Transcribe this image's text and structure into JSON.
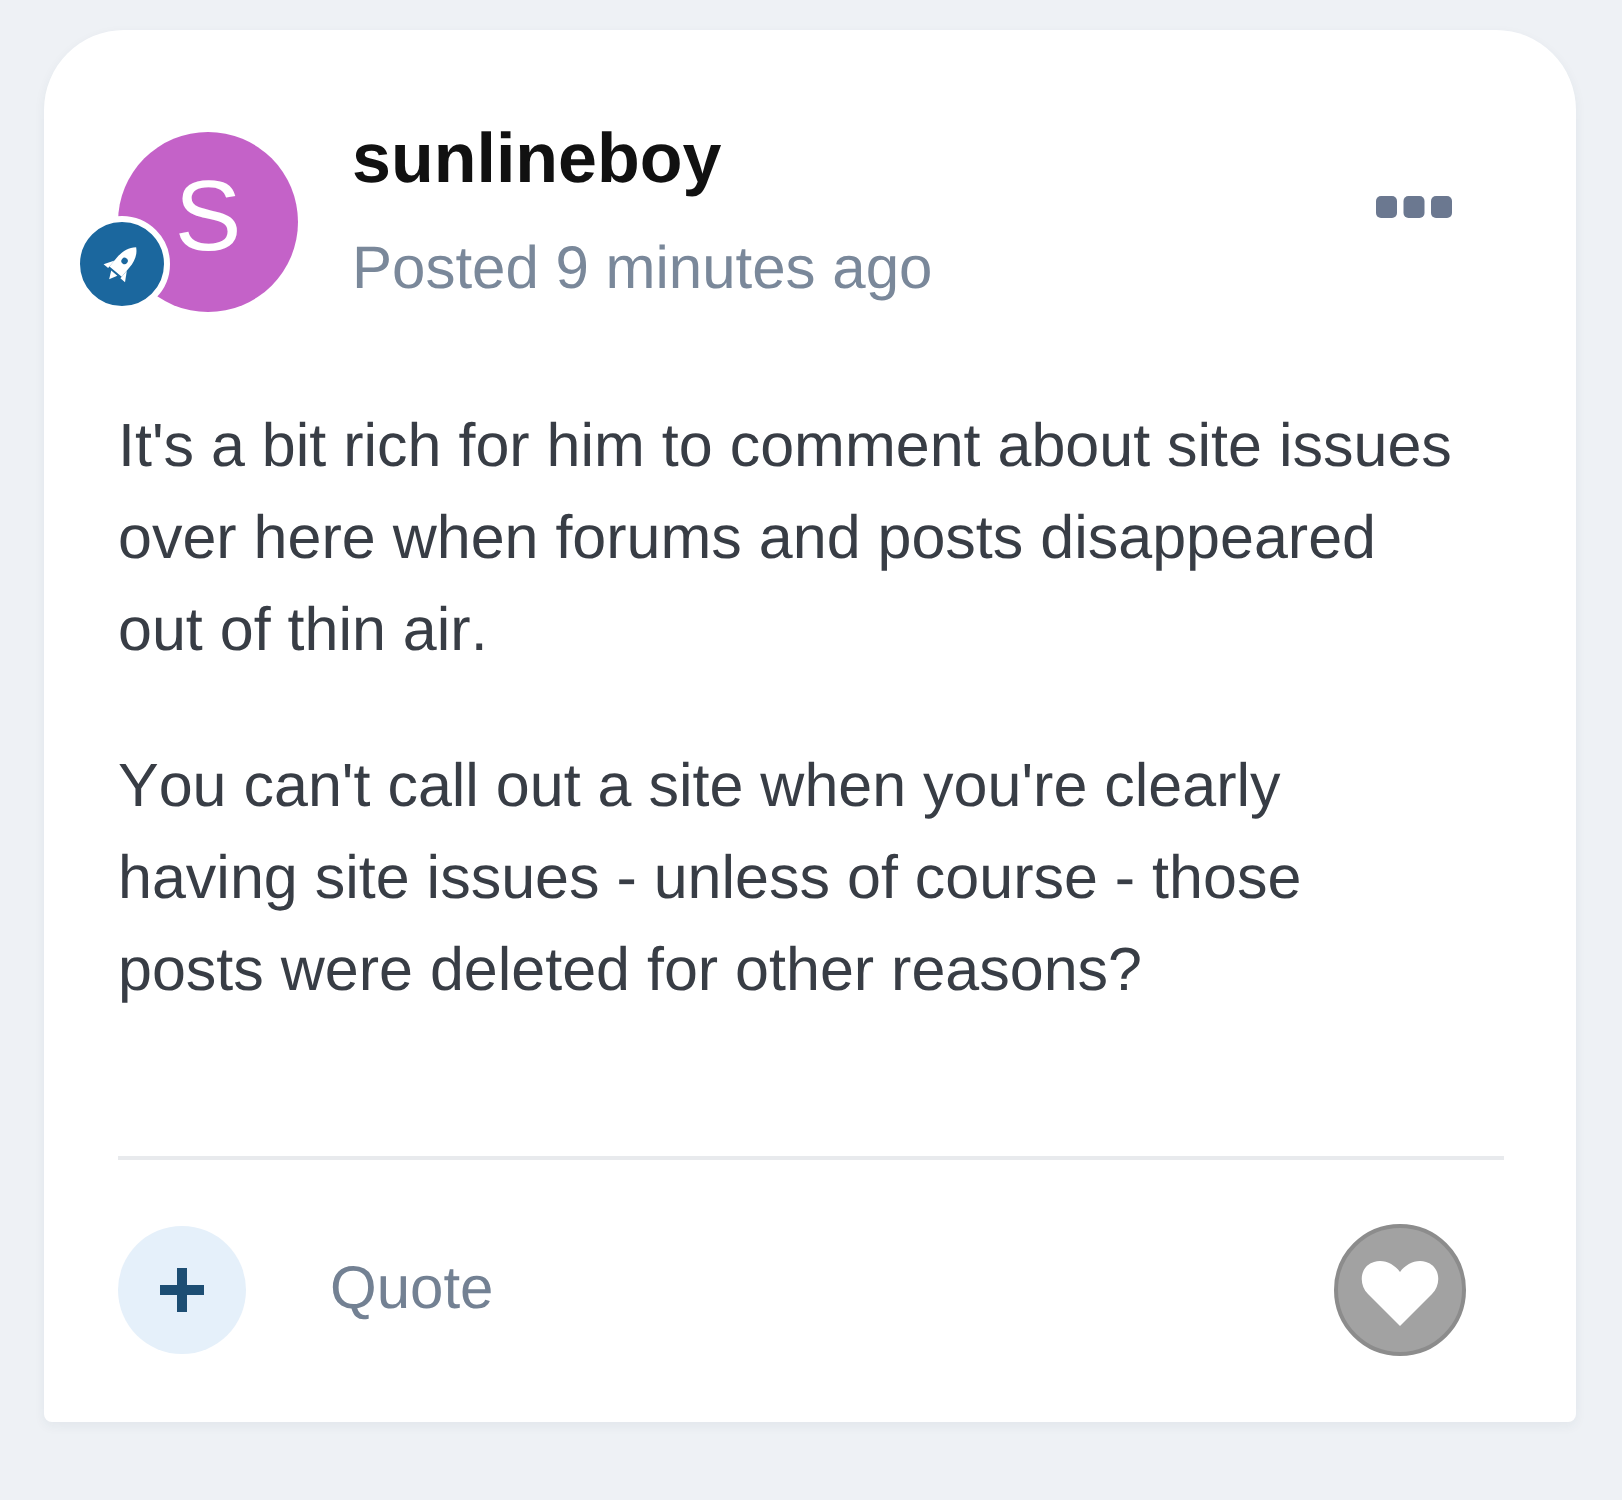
{
  "post": {
    "author": {
      "initial": "S",
      "name": "sunlineboy"
    },
    "posted": "Posted 9 minutes ago",
    "body": [
      "It's a bit rich for him to comment about site issues over here when forums and posts disappeared out of thin air.",
      "You can't call out a site when you're clearly having site issues - unless of course - those posts were deleted for other reasons?"
    ]
  },
  "footer": {
    "quote": "Quote",
    "liked": false
  }
}
